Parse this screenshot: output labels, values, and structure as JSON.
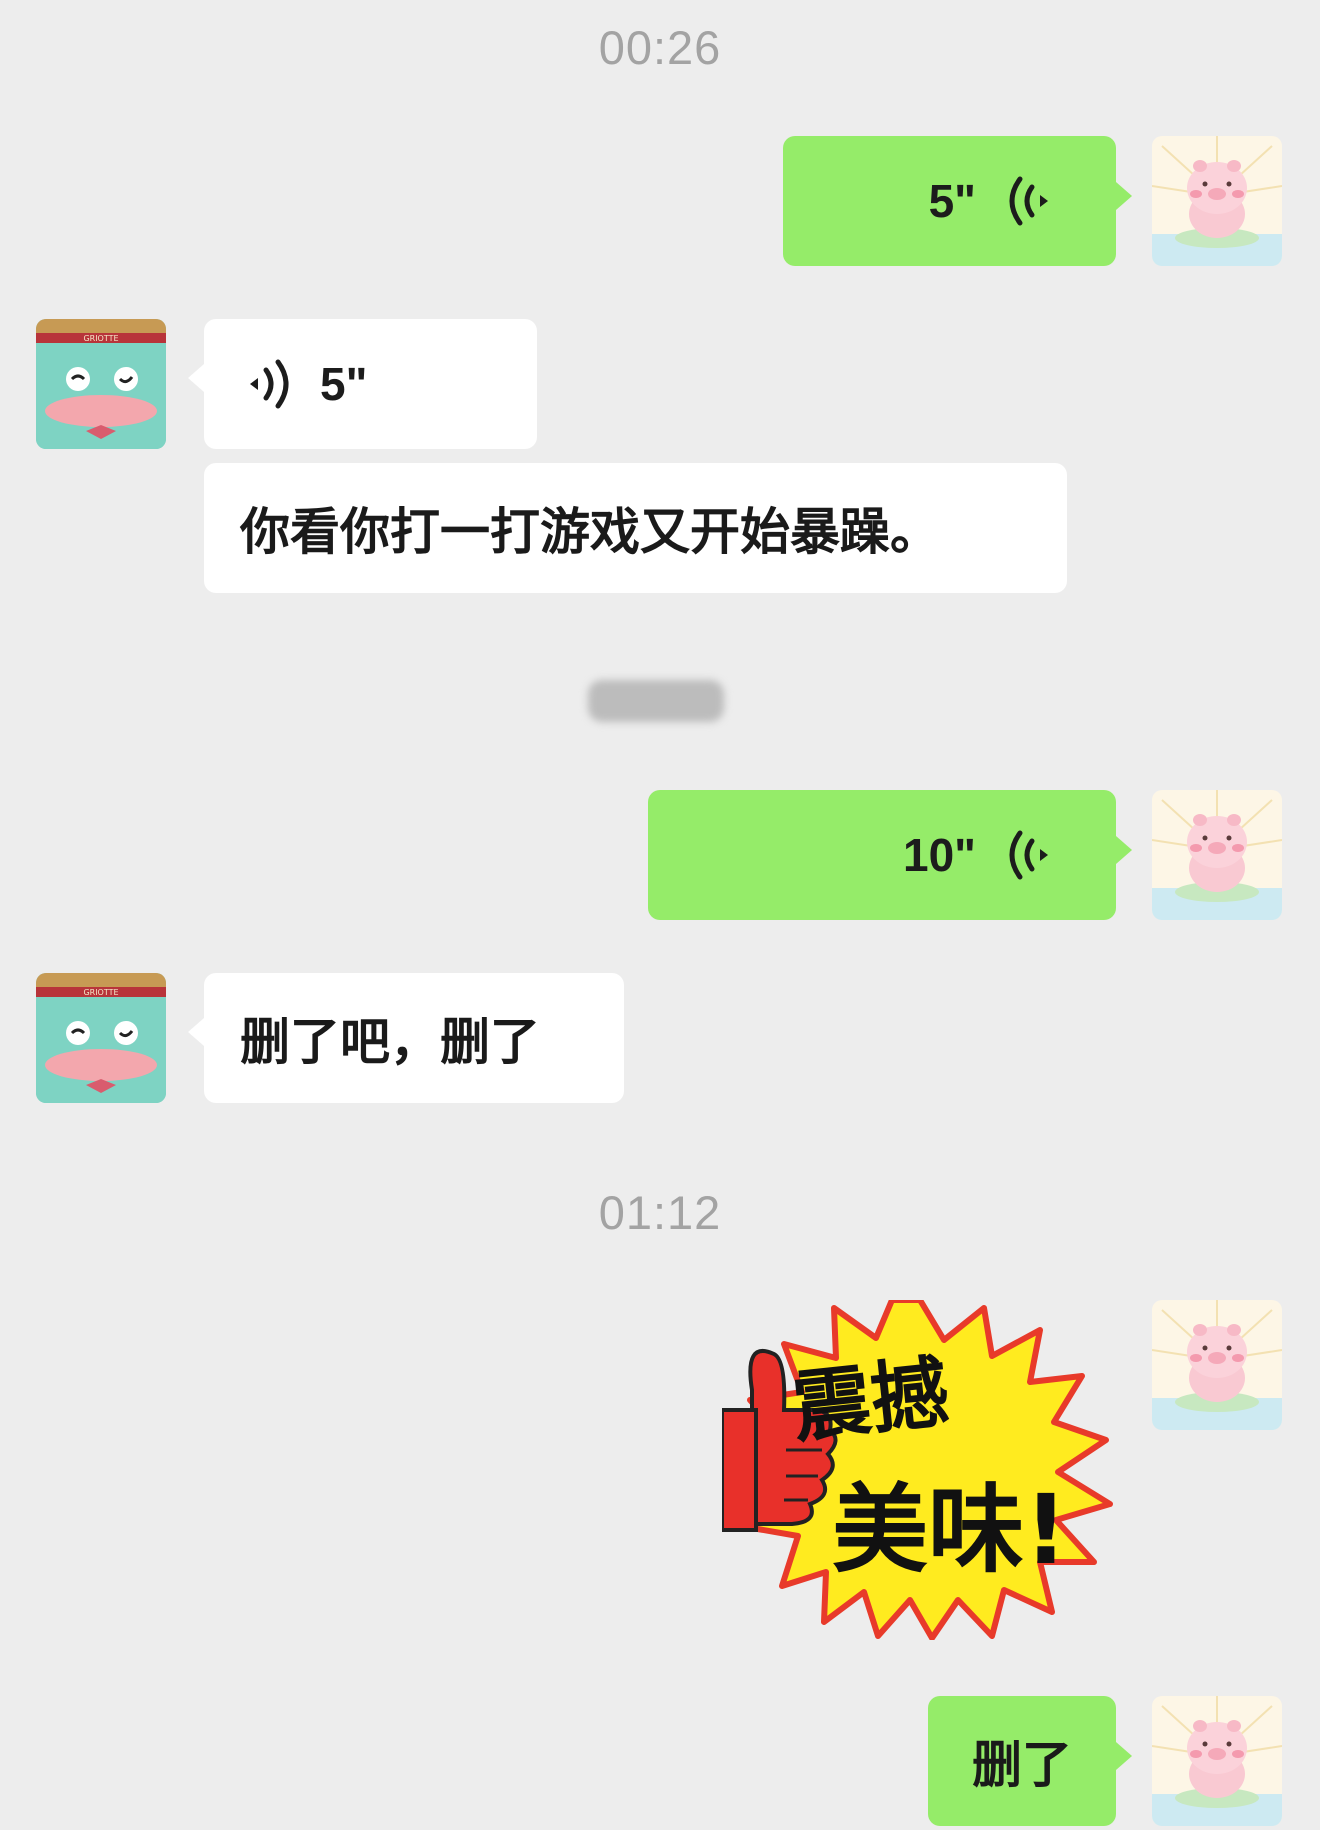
{
  "colors": {
    "background": "#ededed",
    "my_bubble": "#95ec69",
    "their_bubble": "#ffffff",
    "timestamp": "#a3a3a3"
  },
  "timestamps": [
    "00:26",
    "01:12"
  ],
  "messages": [
    {
      "sender": "me",
      "type": "voice",
      "duration": "5\"",
      "icon": "voice-wave-icon"
    },
    {
      "sender": "them",
      "type": "voice",
      "duration": "5\"",
      "icon": "voice-wave-icon"
    },
    {
      "sender": "them",
      "type": "text",
      "text": "你看你打一打游戏又开始暴躁。"
    },
    {
      "sender": "me",
      "type": "voice",
      "duration": "10\"",
      "icon": "voice-wave-icon"
    },
    {
      "sender": "them",
      "type": "text",
      "text": "删了吧，删了"
    },
    {
      "sender": "me",
      "type": "sticker",
      "line1": "震撼",
      "line2": "美味!"
    },
    {
      "sender": "me",
      "type": "text",
      "text": "删了"
    }
  ]
}
